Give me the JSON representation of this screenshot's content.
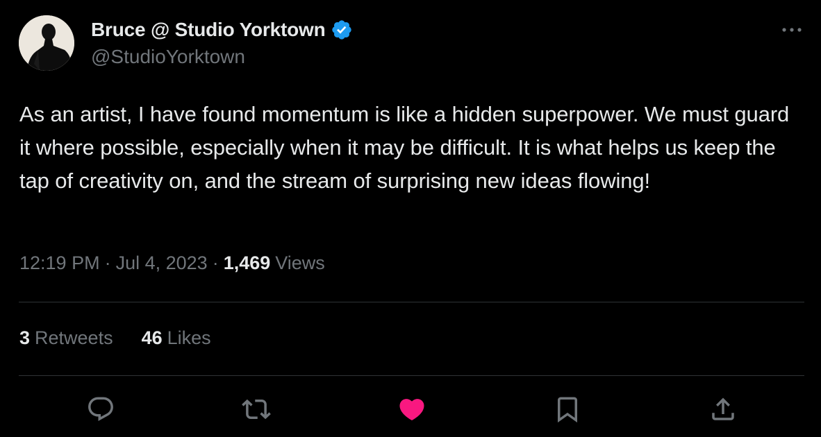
{
  "author": {
    "display_name": "Bruce @ Studio Yorktown",
    "handle": "@StudioYorktown",
    "verified_icon": "verified-badge-icon",
    "verified_color": "#1d9bf0"
  },
  "tweet": {
    "text": "As an artist, I have found momentum is like a hidden superpower. We must guard it where possible, especially when it may be difficult. It is what helps us keep the tap of creativity on, and the stream of surprising new ideas flowing!"
  },
  "meta": {
    "time": "12:19 PM",
    "separator": "·",
    "date": "Jul 4, 2023",
    "views_count": "1,469",
    "views_label": "Views"
  },
  "stats": {
    "retweets_count": "3",
    "retweets_label": "Retweets",
    "likes_count": "46",
    "likes_label": "Likes"
  },
  "actions": [
    {
      "icon": "reply-icon"
    },
    {
      "icon": "retweet-icon"
    },
    {
      "icon": "like-heart-icon",
      "active": true,
      "color": "#f91880"
    },
    {
      "icon": "bookmark-icon"
    },
    {
      "icon": "share-icon"
    }
  ],
  "colors": {
    "background": "#000000",
    "primary_text": "#e7e9ea",
    "secondary_text": "#71767b",
    "divider": "#2f3336",
    "like_active": "#f91880"
  }
}
